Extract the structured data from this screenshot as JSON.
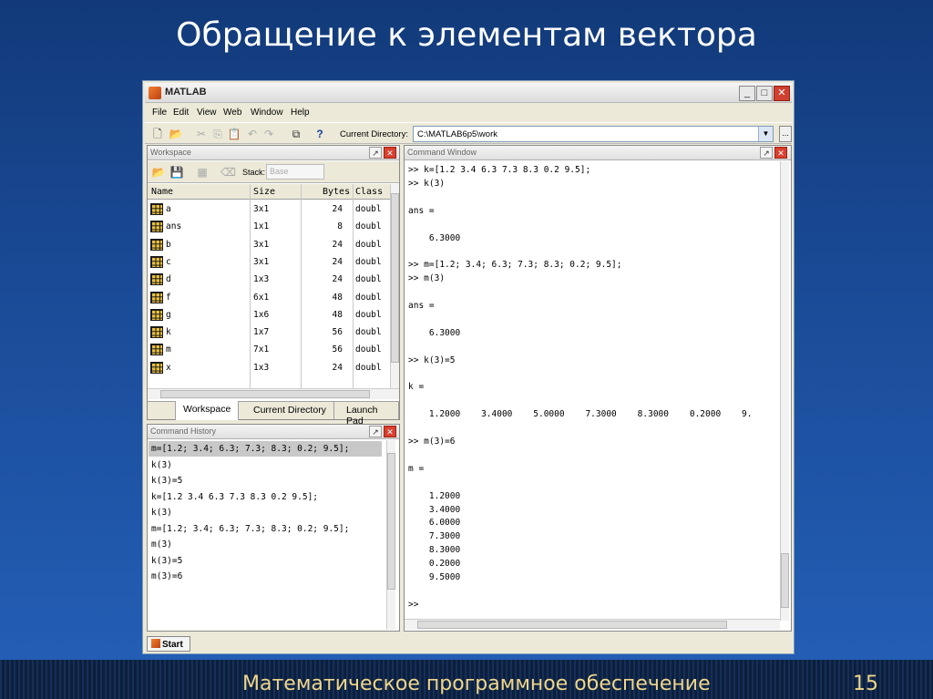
{
  "slide": {
    "title": "Обращение к элементам вектора",
    "footer": "Математическое программное обеспечение",
    "page_number": "15"
  },
  "window": {
    "title": "MATLAB",
    "controls": [
      "_",
      "□",
      "✕"
    ]
  },
  "menu": [
    "File",
    "Edit",
    "View",
    "Web",
    "Window",
    "Help"
  ],
  "toolbar": {
    "current_directory_label": "Current Directory:",
    "current_directory_value": "C:\\MATLAB6p5\\work",
    "browse_label": "..."
  },
  "workspace": {
    "title": "Workspace",
    "stack_label": "Stack:",
    "stack_value": "Base",
    "columns": [
      "Name",
      "Size",
      "Bytes",
      "Class"
    ],
    "rows": [
      {
        "name": "a",
        "size": "3x1",
        "bytes": "24",
        "class": "doubl"
      },
      {
        "name": "ans",
        "size": "1x1",
        "bytes": "8",
        "class": "doubl"
      },
      {
        "name": "b",
        "size": "3x1",
        "bytes": "24",
        "class": "doubl"
      },
      {
        "name": "c",
        "size": "3x1",
        "bytes": "24",
        "class": "doubl"
      },
      {
        "name": "d",
        "size": "1x3",
        "bytes": "24",
        "class": "doubl"
      },
      {
        "name": "f",
        "size": "6x1",
        "bytes": "48",
        "class": "doubl"
      },
      {
        "name": "g",
        "size": "1x6",
        "bytes": "48",
        "class": "doubl"
      },
      {
        "name": "k",
        "size": "1x7",
        "bytes": "56",
        "class": "doubl"
      },
      {
        "name": "m",
        "size": "7x1",
        "bytes": "56",
        "class": "doubl"
      },
      {
        "name": "x",
        "size": "1x3",
        "bytes": "24",
        "class": "doubl"
      }
    ],
    "tabs": [
      "Workspace",
      "Current Directory",
      "Launch Pad"
    ]
  },
  "history": {
    "title": "Command History",
    "lines": [
      "m=[1.2; 3.4; 6.3; 7.3; 8.3; 0.2; 9.5];",
      "k(3)",
      "k(3)=5",
      "k=[1.2 3.4 6.3 7.3 8.3 0.2 9.5];",
      "k(3)",
      "m=[1.2; 3.4; 6.3; 7.3; 8.3; 0.2; 9.5];",
      "m(3)",
      "k(3)=5",
      "m(3)=6"
    ]
  },
  "command": {
    "title": "Command Window",
    "lines": [
      ">> k=[1.2 3.4 6.3 7.3 8.3 0.2 9.5];",
      ">> k(3)",
      "",
      "ans =",
      "",
      "    6.3000",
      "",
      ">> m=[1.2; 3.4; 6.3; 7.3; 8.3; 0.2; 9.5];",
      ">> m(3)",
      "",
      "ans =",
      "",
      "    6.3000",
      "",
      ">> k(3)=5",
      "",
      "k =",
      "",
      "    1.2000    3.4000    5.0000    7.3000    8.3000    0.2000    9.",
      "",
      ">> m(3)=6",
      "",
      "m =",
      "",
      "    1.2000",
      "    3.4000",
      "    6.0000",
      "    7.3000",
      "    8.3000",
      "    0.2000",
      "    9.5000",
      "",
      ">>"
    ]
  },
  "status": {
    "start_label": "Start"
  },
  "colors": {
    "background_top": "#123a7a",
    "background_bottom": "#2460b8",
    "footer_text": "#f0d68a",
    "close_button": "#d04030"
  }
}
